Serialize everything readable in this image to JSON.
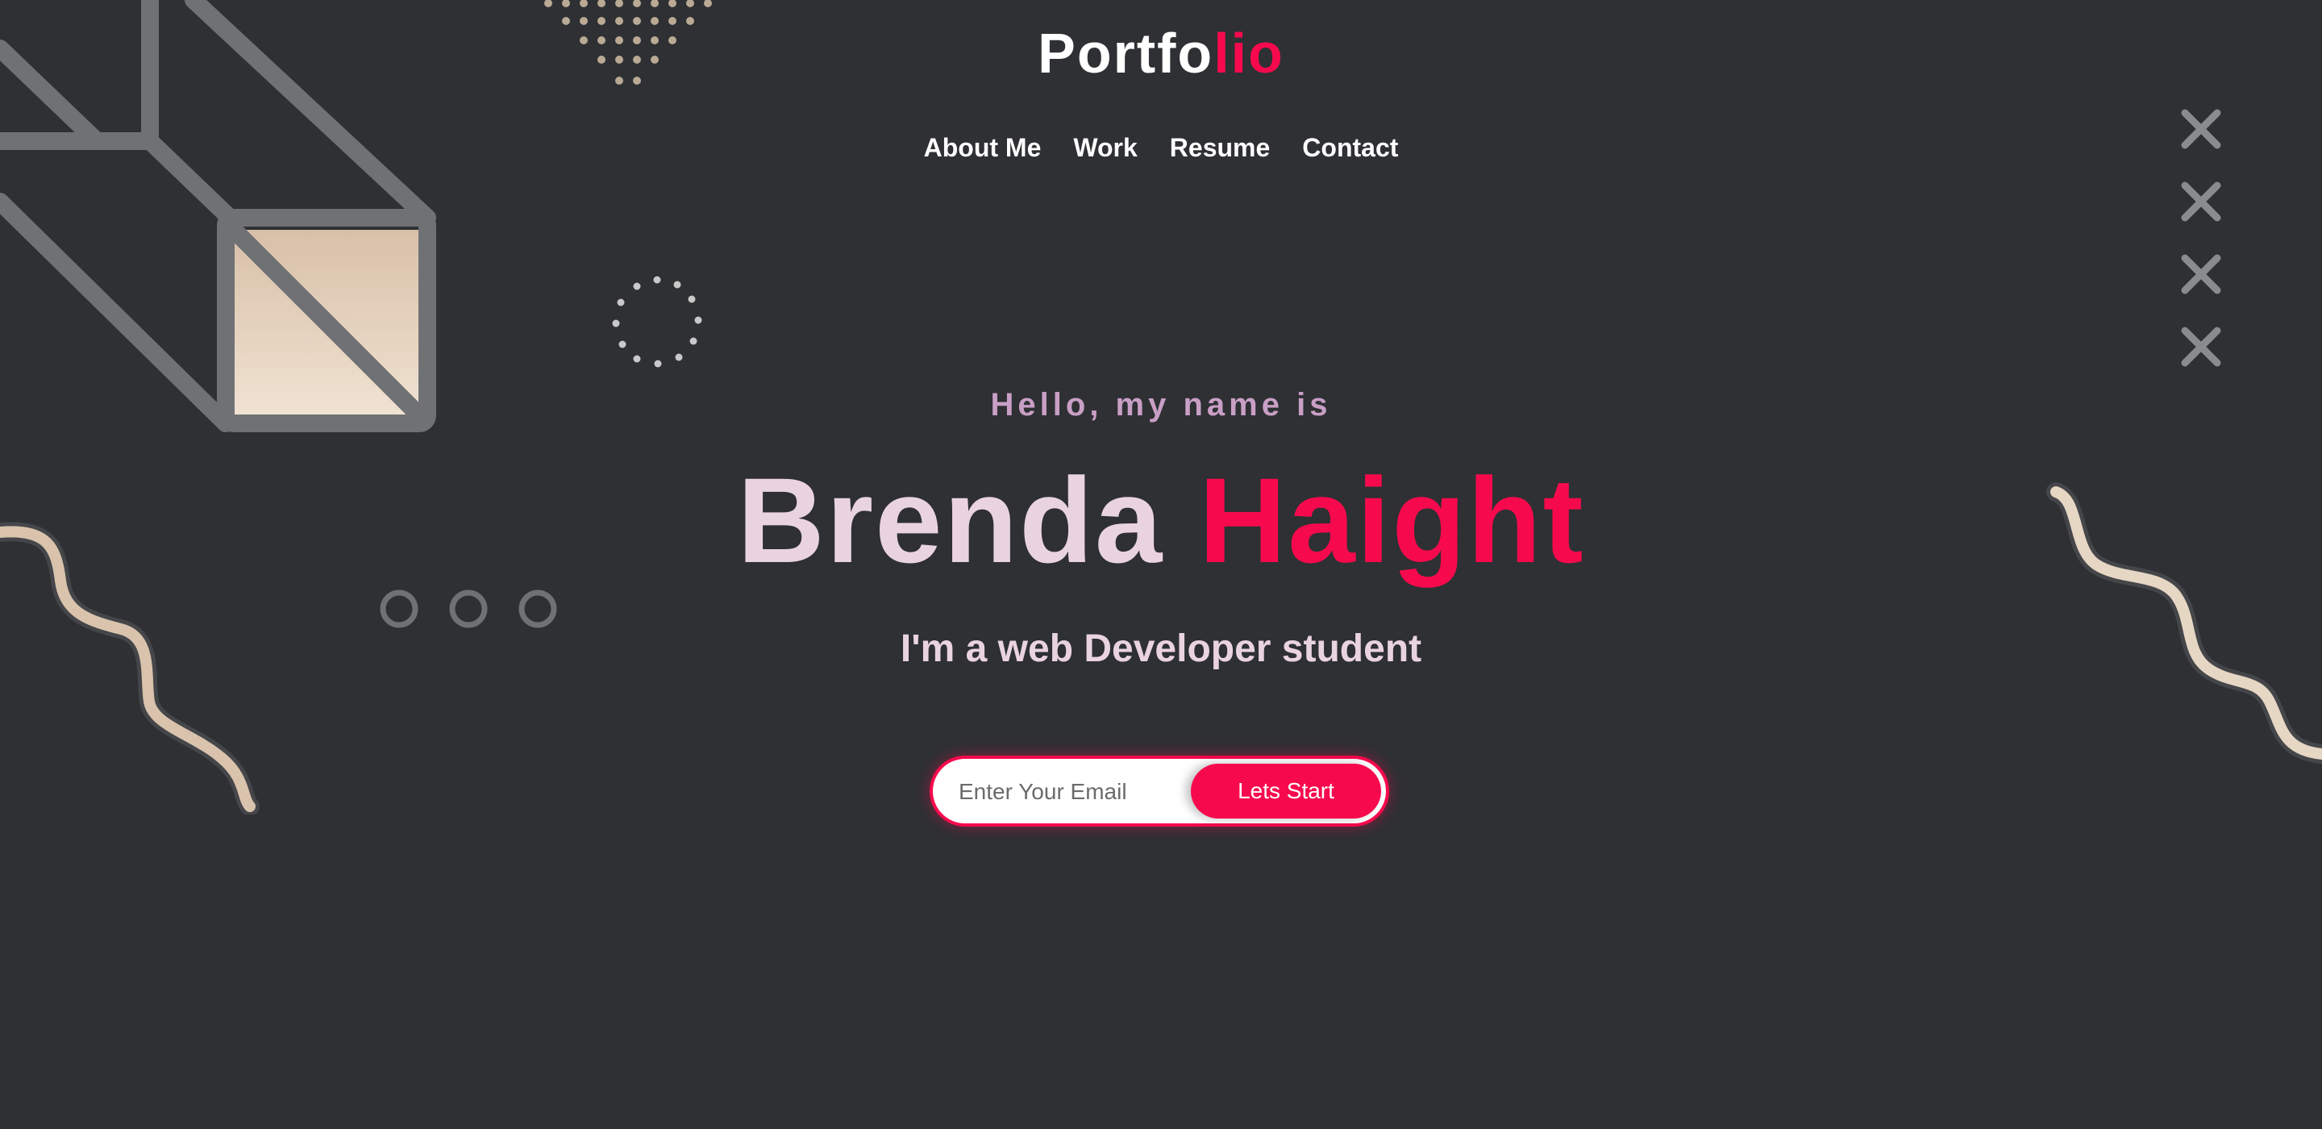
{
  "brand": {
    "main": "Portfo",
    "accent": "lio"
  },
  "nav": [
    {
      "label": "About Me"
    },
    {
      "label": "Work"
    },
    {
      "label": "Resume"
    },
    {
      "label": "Contact"
    }
  ],
  "hero": {
    "greeting": "Hello, my name is",
    "first_name": "Brenda",
    "last_name": "Haight",
    "tagline": "I'm a web Developer student"
  },
  "signup": {
    "placeholder": "Enter Your Email",
    "button_label": "Lets Start"
  },
  "colors": {
    "background": "#2e3033",
    "accent": "#f70a4d",
    "text_light": "#ead3e1",
    "greeting": "#c99fc6"
  }
}
